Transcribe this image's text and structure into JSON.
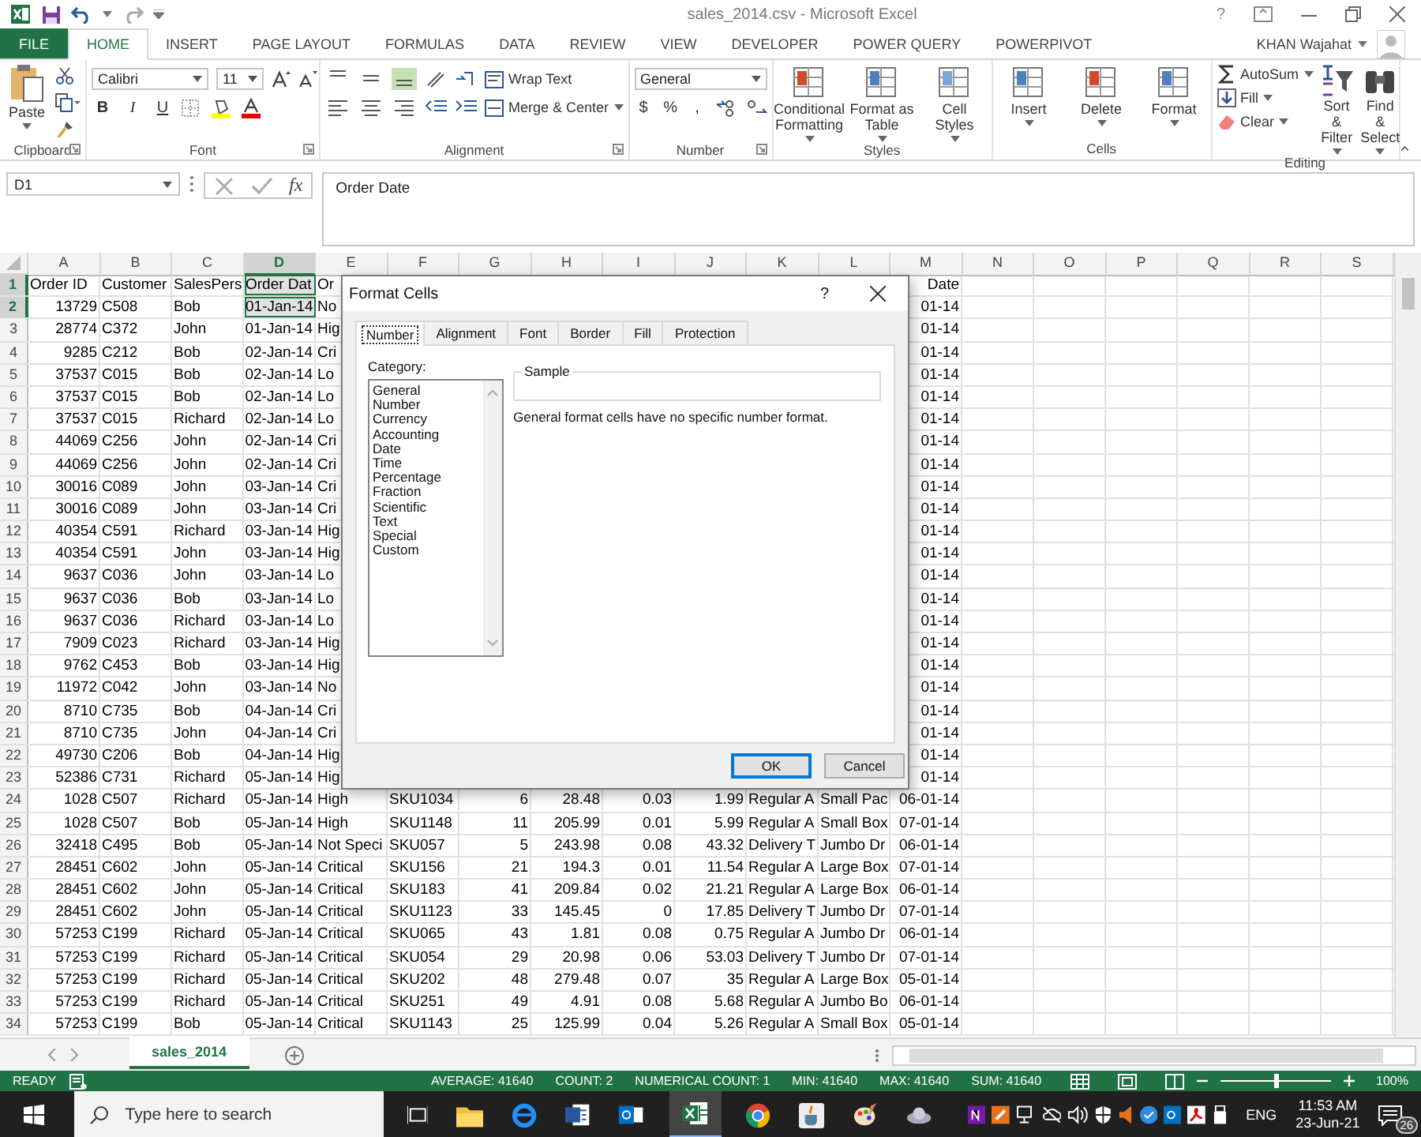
{
  "window": {
    "title": "sales_2014.csv - Microsoft Excel",
    "help": "?"
  },
  "ribbon": {
    "tabs": [
      {
        "label": "FILE",
        "kind": "file",
        "selected": false
      },
      {
        "label": "HOME",
        "kind": "tab",
        "selected": true
      },
      {
        "label": "INSERT",
        "kind": "tab",
        "selected": false
      },
      {
        "label": "PAGE LAYOUT",
        "kind": "tab",
        "selected": false
      },
      {
        "label": "FORMULAS",
        "kind": "tab",
        "selected": false
      },
      {
        "label": "DATA",
        "kind": "tab",
        "selected": false
      },
      {
        "label": "REVIEW",
        "kind": "tab",
        "selected": false
      },
      {
        "label": "VIEW",
        "kind": "tab",
        "selected": false
      },
      {
        "label": "DEVELOPER",
        "kind": "tab",
        "selected": false
      },
      {
        "label": "POWER QUERY",
        "kind": "tab",
        "selected": false
      },
      {
        "label": "POWERPIVOT",
        "kind": "tab",
        "selected": false
      }
    ],
    "account": "KHAN Wajahat",
    "groups": [
      {
        "label": "Clipboard",
        "kind": "clipboard",
        "items": [
          "Paste"
        ],
        "launcher": true
      },
      {
        "label": "Font",
        "kind": "font",
        "font": "Calibri",
        "size": "11",
        "items": [
          "B",
          "I",
          "U"
        ],
        "launcher": true
      },
      {
        "label": "Alignment",
        "kind": "alignment",
        "items": [
          "Wrap Text",
          "Merge & Center"
        ],
        "launcher": true
      },
      {
        "label": "Number",
        "kind": "number",
        "format": "General",
        "items": [
          "$",
          "%",
          ","
        ],
        "launcher": true
      },
      {
        "label": "Styles",
        "kind": "large",
        "items": [
          "Conditional Formatting",
          "Format as Table",
          "Cell Styles"
        ]
      },
      {
        "label": "Cells",
        "kind": "large",
        "items": [
          "Insert",
          "Delete",
          "Format"
        ]
      },
      {
        "label": "Editing",
        "kind": "editing",
        "items": [
          "AutoSum",
          "Fill",
          "Clear"
        ],
        "large": [
          "Sort & Filter",
          "Find & Select"
        ]
      }
    ]
  },
  "formula_bar": {
    "name_box": "D1",
    "function_label": "fx",
    "value": "Order Date"
  },
  "sheet": {
    "columns": [
      {
        "label": "A",
        "selected": false
      },
      {
        "label": "B",
        "selected": false
      },
      {
        "label": "C",
        "selected": false
      },
      {
        "label": "D",
        "selected": true
      },
      {
        "label": "E",
        "selected": false
      },
      {
        "label": "F",
        "selected": false
      },
      {
        "label": "G",
        "selected": false
      },
      {
        "label": "H",
        "selected": false
      },
      {
        "label": "I",
        "selected": false
      },
      {
        "label": "J",
        "selected": false
      },
      {
        "label": "K",
        "selected": false
      },
      {
        "label": "L",
        "selected": false
      },
      {
        "label": "M",
        "selected": false
      },
      {
        "label": "N",
        "selected": false
      },
      {
        "label": "O",
        "selected": false
      },
      {
        "label": "P",
        "selected": false
      },
      {
        "label": "Q",
        "selected": false
      },
      {
        "label": "R",
        "selected": false
      },
      {
        "label": "S",
        "selected": false
      }
    ],
    "rows": [
      {
        "number": "1",
        "selected": true,
        "cells": [
          "Order ID",
          "Customer",
          "SalesPers",
          "Order Dat",
          "Or"
        ],
        "column_m": "Date"
      },
      {
        "number": "2",
        "selected": true,
        "cells": [
          "13729",
          "C508",
          "Bob",
          "01-Jan-14",
          "No"
        ],
        "column_m": "01-14"
      },
      {
        "number": "3",
        "selected": false,
        "cells": [
          "28774",
          "C372",
          "John",
          "01-Jan-14",
          "Hig"
        ],
        "column_m": "01-14"
      },
      {
        "number": "4",
        "selected": false,
        "cells": [
          "9285",
          "C212",
          "Bob",
          "02-Jan-14",
          "Cri"
        ],
        "column_m": "01-14"
      },
      {
        "number": "5",
        "selected": false,
        "cells": [
          "37537",
          "C015",
          "Bob",
          "02-Jan-14",
          "Lo"
        ],
        "column_m": "01-14"
      },
      {
        "number": "6",
        "selected": false,
        "cells": [
          "37537",
          "C015",
          "Bob",
          "02-Jan-14",
          "Lo"
        ],
        "column_m": "01-14"
      },
      {
        "number": "7",
        "selected": false,
        "cells": [
          "37537",
          "C015",
          "Richard",
          "02-Jan-14",
          "Lo"
        ],
        "column_m": "01-14"
      },
      {
        "number": "8",
        "selected": false,
        "cells": [
          "44069",
          "C256",
          "John",
          "02-Jan-14",
          "Cri"
        ],
        "column_m": "01-14"
      },
      {
        "number": "9",
        "selected": false,
        "cells": [
          "44069",
          "C256",
          "John",
          "02-Jan-14",
          "Cri"
        ],
        "column_m": "01-14"
      },
      {
        "number": "10",
        "selected": false,
        "cells": [
          "30016",
          "C089",
          "John",
          "03-Jan-14",
          "Cri"
        ],
        "column_m": "01-14"
      },
      {
        "number": "11",
        "selected": false,
        "cells": [
          "30016",
          "C089",
          "John",
          "03-Jan-14",
          "Cri"
        ],
        "column_m": "01-14"
      },
      {
        "number": "12",
        "selected": false,
        "cells": [
          "40354",
          "C591",
          "Richard",
          "03-Jan-14",
          "Hig"
        ],
        "column_m": "01-14"
      },
      {
        "number": "13",
        "selected": false,
        "cells": [
          "40354",
          "C591",
          "John",
          "03-Jan-14",
          "Hig"
        ],
        "column_m": "01-14"
      },
      {
        "number": "14",
        "selected": false,
        "cells": [
          "9637",
          "C036",
          "John",
          "03-Jan-14",
          "Lo"
        ],
        "column_m": "01-14"
      },
      {
        "number": "15",
        "selected": false,
        "cells": [
          "9637",
          "C036",
          "Bob",
          "03-Jan-14",
          "Lo"
        ],
        "column_m": "01-14"
      },
      {
        "number": "16",
        "selected": false,
        "cells": [
          "9637",
          "C036",
          "Richard",
          "03-Jan-14",
          "Lo"
        ],
        "column_m": "01-14"
      },
      {
        "number": "17",
        "selected": false,
        "cells": [
          "7909",
          "C023",
          "Richard",
          "03-Jan-14",
          "Hig"
        ],
        "column_m": "01-14"
      },
      {
        "number": "18",
        "selected": false,
        "cells": [
          "9762",
          "C453",
          "Bob",
          "03-Jan-14",
          "Hig"
        ],
        "column_m": "01-14"
      },
      {
        "number": "19",
        "selected": false,
        "cells": [
          "11972",
          "C042",
          "John",
          "03-Jan-14",
          "No"
        ],
        "column_m": "01-14"
      },
      {
        "number": "20",
        "selected": false,
        "cells": [
          "8710",
          "C735",
          "Bob",
          "04-Jan-14",
          "Cri"
        ],
        "column_m": "01-14"
      },
      {
        "number": "21",
        "selected": false,
        "cells": [
          "8710",
          "C735",
          "John",
          "04-Jan-14",
          "Cri"
        ],
        "column_m": "01-14"
      },
      {
        "number": "22",
        "selected": false,
        "cells": [
          "49730",
          "C206",
          "Bob",
          "04-Jan-14",
          "Hig"
        ],
        "column_m": "01-14"
      },
      {
        "number": "23",
        "selected": false,
        "cells": [
          "52386",
          "C731",
          "Richard",
          "05-Jan-14",
          "Hig"
        ],
        "column_m": "01-14"
      },
      {
        "number": "24",
        "selected": false,
        "cells": [
          "1028",
          "C507",
          "Richard",
          "05-Jan-14",
          "High",
          "SKU1034",
          "6",
          "28.48",
          "0.03",
          "1.99",
          "Regular A",
          "Small Pac",
          "06-01-14"
        ]
      },
      {
        "number": "25",
        "selected": false,
        "cells": [
          "1028",
          "C507",
          "Bob",
          "05-Jan-14",
          "High",
          "SKU1148",
          "11",
          "205.99",
          "0.01",
          "5.99",
          "Regular A",
          "Small Box",
          "07-01-14"
        ]
      },
      {
        "number": "26",
        "selected": false,
        "cells": [
          "32418",
          "C495",
          "Bob",
          "05-Jan-14",
          "Not Speci",
          "SKU057",
          "5",
          "243.98",
          "0.08",
          "43.32",
          "Delivery T",
          "Jumbo Dr",
          "06-01-14"
        ]
      },
      {
        "number": "27",
        "selected": false,
        "cells": [
          "28451",
          "C602",
          "John",
          "05-Jan-14",
          "Critical",
          "SKU156",
          "21",
          "194.3",
          "0.01",
          "11.54",
          "Regular A",
          "Large Box",
          "07-01-14"
        ]
      },
      {
        "number": "28",
        "selected": false,
        "cells": [
          "28451",
          "C602",
          "John",
          "05-Jan-14",
          "Critical",
          "SKU183",
          "41",
          "209.84",
          "0.02",
          "21.21",
          "Regular A",
          "Large Box",
          "06-01-14"
        ]
      },
      {
        "number": "29",
        "selected": false,
        "cells": [
          "28451",
          "C602",
          "John",
          "05-Jan-14",
          "Critical",
          "SKU1123",
          "33",
          "145.45",
          "0",
          "17.85",
          "Delivery T",
          "Jumbo Dr",
          "07-01-14"
        ]
      },
      {
        "number": "30",
        "selected": false,
        "cells": [
          "57253",
          "C199",
          "Richard",
          "05-Jan-14",
          "Critical",
          "SKU065",
          "43",
          "1.81",
          "0.08",
          "0.75",
          "Regular A",
          "Jumbo Dr",
          "06-01-14"
        ]
      },
      {
        "number": "31",
        "selected": false,
        "cells": [
          "57253",
          "C199",
          "Richard",
          "05-Jan-14",
          "Critical",
          "SKU054",
          "29",
          "20.98",
          "0.06",
          "53.03",
          "Delivery T",
          "Jumbo Dr",
          "07-01-14"
        ]
      },
      {
        "number": "32",
        "selected": false,
        "cells": [
          "57253",
          "C199",
          "Richard",
          "05-Jan-14",
          "Critical",
          "SKU202",
          "48",
          "279.48",
          "0.07",
          "35",
          "Regular A",
          "Large Box",
          "05-01-14"
        ]
      },
      {
        "number": "33",
        "selected": false,
        "cells": [
          "57253",
          "C199",
          "Richard",
          "05-Jan-14",
          "Critical",
          "SKU251",
          "49",
          "4.91",
          "0.08",
          "5.68",
          "Regular A",
          "Jumbo Bo",
          "06-01-14"
        ]
      },
      {
        "number": "34",
        "selected": false,
        "cells": [
          "57253",
          "C199",
          "Bob",
          "05-Jan-14",
          "Critical",
          "SKU1143",
          "25",
          "125.99",
          "0.04",
          "5.26",
          "Regular A",
          "Small Box",
          "05-01-14"
        ]
      }
    ]
  },
  "dialog": {
    "title": "Format Cells",
    "help": "?",
    "tabs": [
      {
        "label": "Number",
        "selected": true
      },
      {
        "label": "Alignment",
        "selected": false
      },
      {
        "label": "Font",
        "selected": false
      },
      {
        "label": "Border",
        "selected": false
      },
      {
        "label": "Fill",
        "selected": false
      },
      {
        "label": "Protection",
        "selected": false
      }
    ],
    "category_label": "Category:",
    "categories": [
      {
        "label": "General",
        "selected": false
      },
      {
        "label": "Number",
        "selected": false
      },
      {
        "label": "Currency",
        "selected": false
      },
      {
        "label": "Accounting",
        "selected": false
      },
      {
        "label": "Date",
        "selected": false
      },
      {
        "label": "Time",
        "selected": false
      },
      {
        "label": "Percentage",
        "selected": false
      },
      {
        "label": "Fraction",
        "selected": false
      },
      {
        "label": "Scientific",
        "selected": false
      },
      {
        "label": "Text",
        "selected": false
      },
      {
        "label": "Special",
        "selected": false
      },
      {
        "label": "Custom",
        "selected": false
      }
    ],
    "sample_label": "Sample",
    "description": "General format cells have no specific number format.",
    "buttons": [
      {
        "label": "OK",
        "kind": "default"
      },
      {
        "label": "Cancel",
        "kind": "normal"
      }
    ]
  },
  "sheet_tabs": [
    {
      "label": "sales_2014",
      "selected": true
    }
  ],
  "status_bar": {
    "mode": "READY",
    "stats": [
      "AVERAGE: 41640",
      "COUNT: 2",
      "NUMERICAL COUNT: 1",
      "MIN: 41640",
      "MAX: 41640",
      "SUM: 41640"
    ],
    "zoom": {
      "level": 0.5
    },
    "zoom_label": "100%"
  },
  "taskbar": {
    "search": {
      "placeholder": "Type here to search"
    },
    "language": "ENG",
    "time": "11:53 AM",
    "date": "23-Jun-21",
    "notifications": "26"
  }
}
